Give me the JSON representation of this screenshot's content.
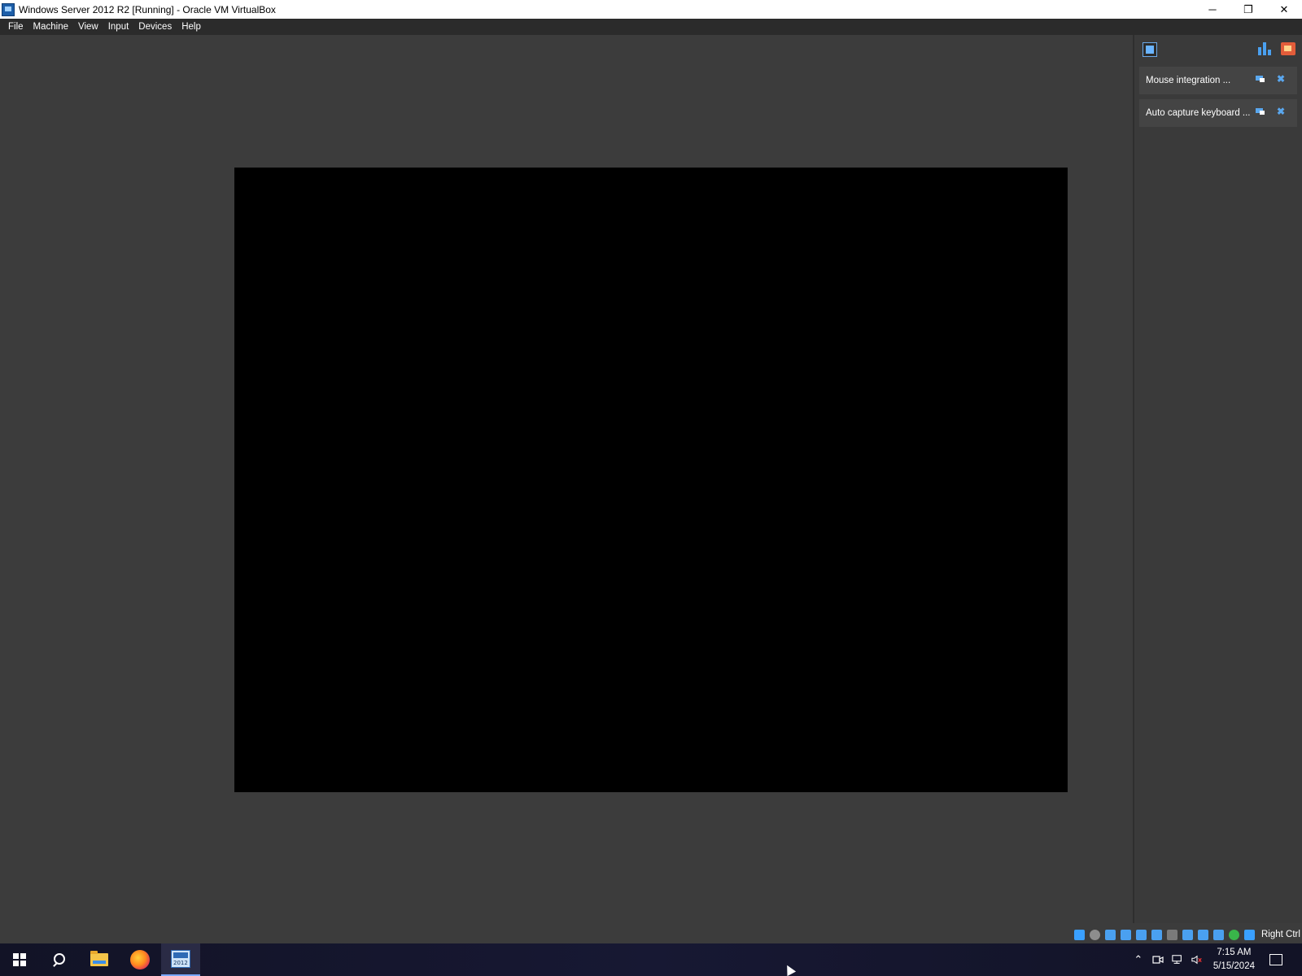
{
  "window": {
    "title": "Windows Server 2012 R2 [Running] - Oracle VM VirtualBox",
    "controls": {
      "minimize": "─",
      "restore": "❐",
      "close": "✕"
    }
  },
  "menu": {
    "items": [
      {
        "label": "File"
      },
      {
        "label": "Machine"
      },
      {
        "label": "View"
      },
      {
        "label": "Input"
      },
      {
        "label": "Devices"
      },
      {
        "label": "Help"
      }
    ]
  },
  "vm": {
    "screen_color": "#000000",
    "background_color": "#3c3c3c"
  },
  "notification_panel": {
    "notifications": [
      {
        "text": "Mouse integration ...",
        "toggle_icon": "popup-toggle-icon",
        "close_icon": "close-icon"
      },
      {
        "text": "Auto capture keyboard ...",
        "toggle_icon": "popup-toggle-icon",
        "close_icon": "close-icon"
      }
    ],
    "close_glyph": "✖"
  },
  "status_bar": {
    "host_key": "Right Ctrl",
    "icons": [
      {
        "name": "network-activity-icon",
        "color": "#3aa0ff"
      },
      {
        "name": "optical-drive-icon",
        "color": "#8d8d8d"
      },
      {
        "name": "hard-disk-icon",
        "color": "#4aa0f0"
      },
      {
        "name": "audio-icon",
        "color": "#4aa0f0"
      },
      {
        "name": "network-adapter-icon",
        "color": "#4aa0f0"
      },
      {
        "name": "usb-icon",
        "color": "#4aa0f0"
      },
      {
        "name": "shared-folders-icon",
        "color": "#7a7a7a"
      },
      {
        "name": "display-icon",
        "color": "#4aa0f0"
      },
      {
        "name": "recording-icon",
        "color": "#4aa0f0"
      },
      {
        "name": "vt-x-icon",
        "color": "#4aa0f0"
      },
      {
        "name": "guest-additions-icon",
        "color": "#39b54a"
      },
      {
        "name": "mouse-integration-icon",
        "color": "#3aa0ff"
      }
    ]
  },
  "taskbar": {
    "apps": [
      {
        "name": "start-button"
      },
      {
        "name": "search-button"
      },
      {
        "name": "file-explorer"
      },
      {
        "name": "firefox"
      },
      {
        "name": "virtualbox",
        "active": true
      }
    ],
    "tray": {
      "chevron": "⌃",
      "time": "7:15 AM",
      "date": "5/15/2024"
    }
  }
}
